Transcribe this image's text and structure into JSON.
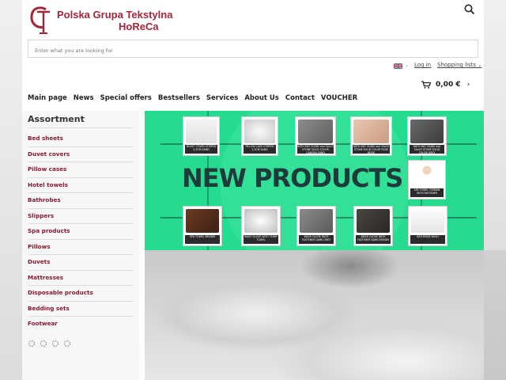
{
  "brand": {
    "line1": "Polska Grupa Tekstylna",
    "line2": "HoReCa",
    "color": "#a3273a"
  },
  "search": {
    "placeholder": "Enter what you are looking for"
  },
  "utility": {
    "login": "Log in",
    "shopping_lists": "Shopping lists"
  },
  "nav": {
    "items": [
      {
        "label": "Main page"
      },
      {
        "label": "News"
      },
      {
        "label": "Special offers"
      },
      {
        "label": "Bestsellers"
      },
      {
        "label": "Services"
      },
      {
        "label": "About Us"
      },
      {
        "label": "Contact"
      },
      {
        "label": "VOUCHER"
      }
    ]
  },
  "cart": {
    "total": "0,00 €"
  },
  "sidebar": {
    "title": "Assortment",
    "categories": [
      {
        "label": "Bed sheets"
      },
      {
        "label": "Duvet covers"
      },
      {
        "label": "Pillow cases"
      },
      {
        "label": "Hotel towels"
      },
      {
        "label": "Bathrobes"
      },
      {
        "label": "Slippers"
      },
      {
        "label": "Spa products"
      },
      {
        "label": "Pillows"
      },
      {
        "label": "Duvets"
      },
      {
        "label": "Mattresses"
      },
      {
        "label": "Disposable products"
      },
      {
        "label": "Bedding sets"
      },
      {
        "label": "Footwear"
      }
    ]
  },
  "banner": {
    "title": "NEW PRODUCTS",
    "bg_color": "#25db8f",
    "products": [
      {
        "caption": "DUVET COVER STRIPED 2,5CM SAND"
      },
      {
        "caption": "PILLOW CASE STRIPED 2,5CM SAND"
      },
      {
        "caption": "BATH MAT 50X80 and 50x25 STONE SOLID COLOR CANYON SAND"
      },
      {
        "caption": "BATH MAT 50X80 and 50x25 STONE SOLID COLOR ROSE BEIGE"
      },
      {
        "caption": "BATH MAT 50X80 and 50x25 STONE SOLID COLOR GREY"
      },
      {
        "caption": "SPA TOWEL TURBAN WITH FASTENER"
      },
      {
        "caption": "SPA TOWEL BROWN"
      },
      {
        "caption": "WASH GLOVE WITH TERRY TOWEL"
      },
      {
        "caption": "WASH GLOVE WITH FASTENER DARK GREY"
      },
      {
        "caption": "WASH GLOVE WITH FASTENER DARK BROWN"
      },
      {
        "caption": "BATHROBE NUSH"
      }
    ]
  },
  "colors": {
    "category_link": "#8a1a2f",
    "banner_green": "#25db8f",
    "banner_text": "#1e3a3a"
  }
}
